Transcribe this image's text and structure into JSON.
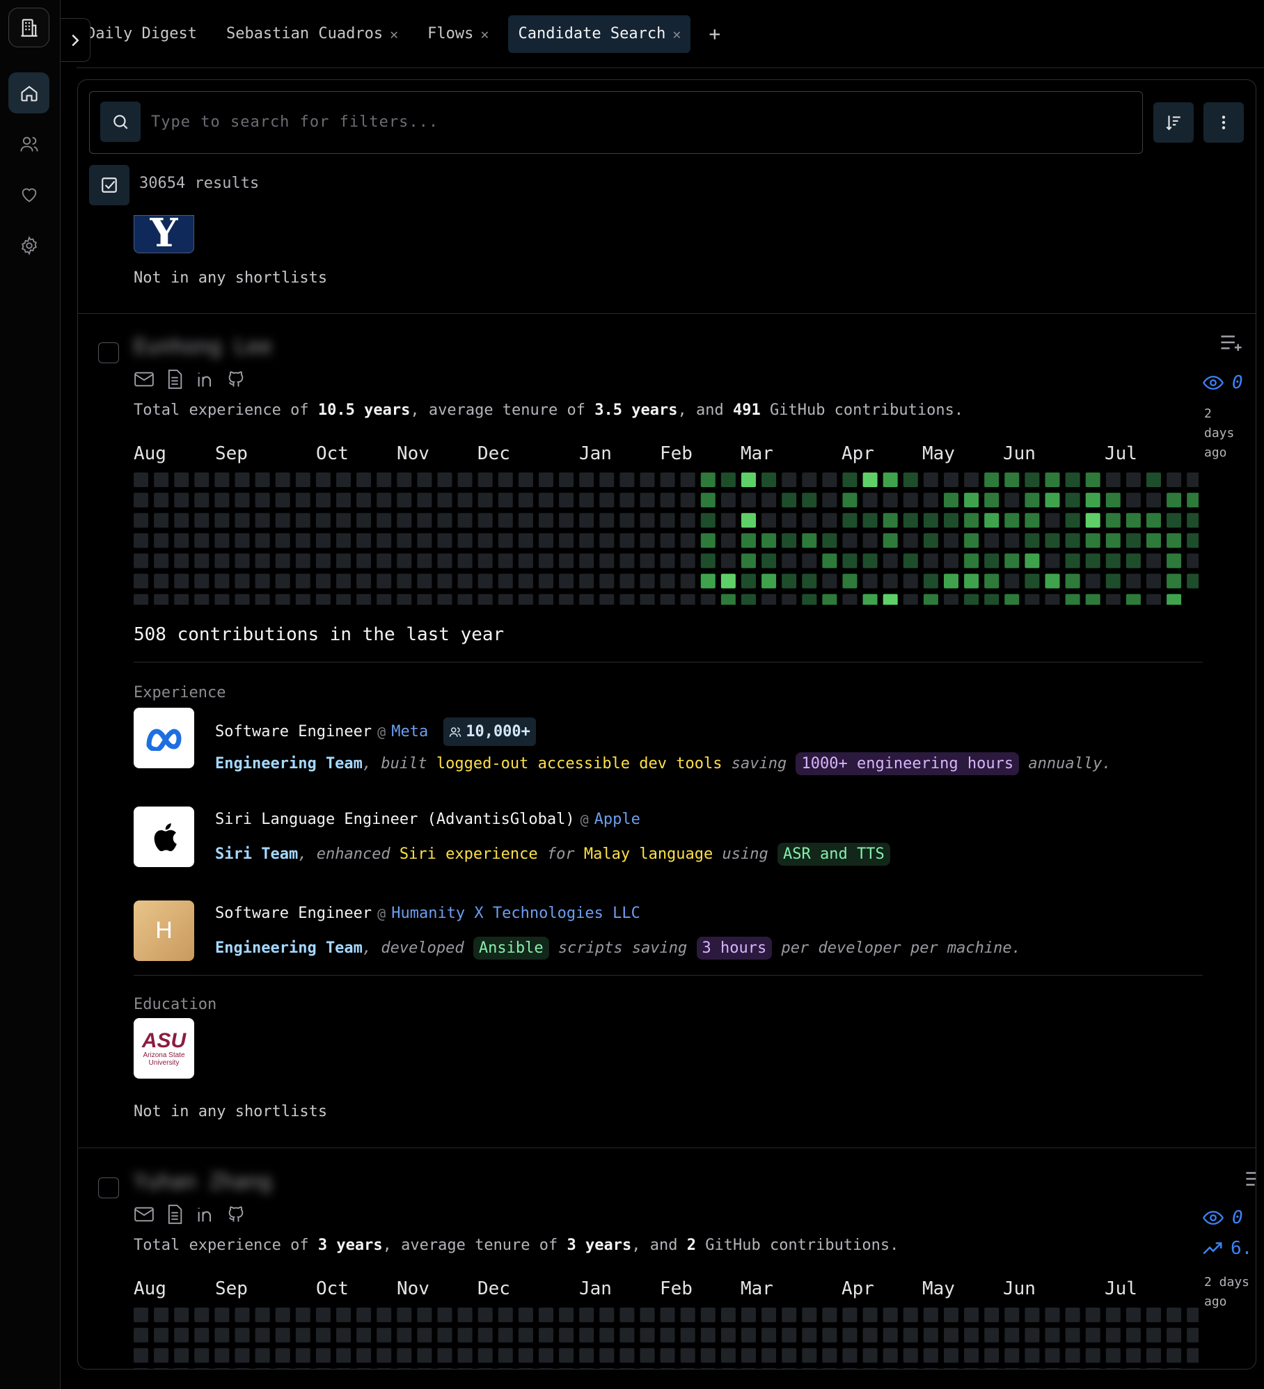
{
  "tabs": [
    {
      "label": "Daily Digest",
      "closable": false,
      "active": false
    },
    {
      "label": "Sebastian Cuadros",
      "closable": true,
      "active": false
    },
    {
      "label": "Flows",
      "closable": true,
      "active": false
    },
    {
      "label": "Candidate Search",
      "closable": true,
      "active": true
    }
  ],
  "tab_add": "+",
  "search": {
    "placeholder": "Type to search for filters..."
  },
  "results_label": "30654 results",
  "prev_card": {
    "school_logo_text": "Y",
    "shortlist": "Not in any shortlists"
  },
  "candidate1": {
    "name": "Eunhong Lee",
    "summary": {
      "p1": "Total experience of ",
      "total": "10.5 years",
      "p2": ", average tenure of ",
      "tenure": "3.5 years",
      "p3": ", and ",
      "github": "491",
      "p4": " GitHub contributions."
    },
    "views": "0",
    "ago": [
      "2",
      "days",
      "ago"
    ],
    "months": [
      "Aug",
      "Sep",
      "Oct",
      "Nov",
      "Dec",
      "Jan",
      "Feb",
      "Mar",
      "Apr",
      "May",
      "Jun",
      "Jul"
    ],
    "contributions_label": "508 contributions in the last year",
    "experience_label": "Experience",
    "experience": [
      {
        "title": "Software Engineer",
        "at": "@",
        "company": "Meta",
        "size": "10,000+",
        "team": "Engineering Team",
        "d1": ", ",
        "d2": "built",
        "d3": " logged-out accessible dev tools ",
        "d4": "saving",
        "d5": "1000+ engineering hours",
        "d6": "annually."
      },
      {
        "title": "Siri Language Engineer (AdvantisGlobal)",
        "at": "@",
        "company": "Apple",
        "team": "Siri Team",
        "d1": ", ",
        "d2": "enhanced",
        "d3": " Siri experience ",
        "d4": "for",
        "d5": " Malay language ",
        "d6": "using",
        "d7": "ASR and TTS"
      },
      {
        "title": "Software Engineer",
        "at": "@",
        "company": "Humanity X Technologies LLC",
        "logo_letter": "H",
        "team": "Engineering Team",
        "d1": ", ",
        "d2": "developed",
        "d3": "Ansible",
        "d4": "scripts saving",
        "d5": "3 hours",
        "d6": "per developer per machine."
      }
    ],
    "education_label": "Education",
    "education_logo": {
      "big": "ASU",
      "small1": "Arizona State",
      "small2": "University"
    },
    "shortlist": "Not in any shortlists"
  },
  "candidate2": {
    "name": "Yuhan Zhang",
    "summary": {
      "p1": "Total experience of ",
      "total": "3 years",
      "p2": ", average tenure of ",
      "tenure": "3 years",
      "p3": ", and ",
      "github": "2",
      "p4": " GitHub contributions."
    },
    "views": "0",
    "stat": "6.",
    "ago": [
      "2 days",
      "ago"
    ],
    "months": [
      "Aug",
      "Sep",
      "Oct",
      "Nov",
      "Dec",
      "Jan",
      "Feb",
      "Mar",
      "Apr",
      "May",
      "Jun",
      "Jul"
    ]
  },
  "colors": {
    "cell_empty": "#1f2226",
    "level1": "#1e4d2b",
    "level2": "#2d7a3a",
    "level3": "#3fa34d",
    "level4": "#5fd068",
    "accent_blue": "#3b82f6"
  }
}
